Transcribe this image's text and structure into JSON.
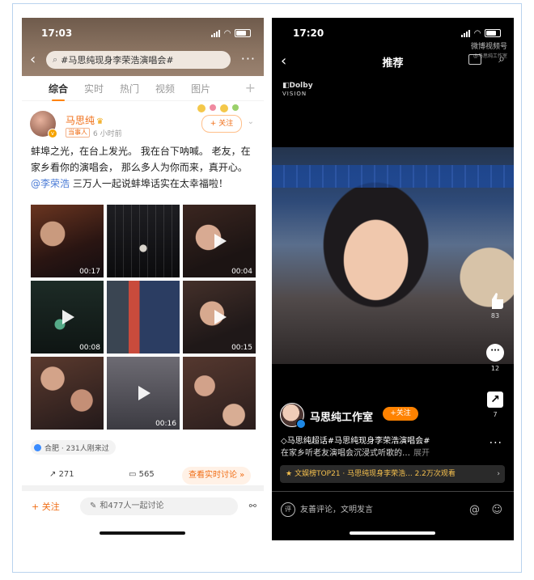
{
  "left": {
    "status": {
      "time": "17:03"
    },
    "search": {
      "query": "#马思纯现身李荣浩演唱会#"
    },
    "tabs": [
      "综合",
      "实时",
      "热门",
      "视频",
      "图片"
    ],
    "post": {
      "author": "马思纯",
      "role_badge": "当事人",
      "time": "6 小时前",
      "follow": "+ 关注",
      "text_a": "蚌埠之光，在台上发光。 我在台下呐喊。 老友，在家乡看你的演唱会， 那么多人为你而来，真开心。",
      "mention": "@李荣浩",
      "text_b": " 三万人一起说蚌埠话实在太幸福啦！",
      "media_durations": [
        "00:17",
        "",
        "00:04",
        "00:08",
        "",
        "00:15",
        "",
        "00:16",
        ""
      ],
      "location": "合肥 · 231人刚来过",
      "reposts": "271",
      "comments": "565",
      "discuss_realtime": "查看实时讨论"
    },
    "bottom": {
      "follow": "+ 关注",
      "comment_box": "和477人一起讨论"
    }
  },
  "right": {
    "status": {
      "time": "17:20"
    },
    "title": "推荐",
    "watermark": "微博视频号",
    "watermark_sub": "@马思纯工作室",
    "dolby": "Dolby",
    "dolby_sub": "VISION",
    "likes": "83",
    "comments": "12",
    "shares": "7",
    "author": "马思纯工作室",
    "follow": "+关注",
    "desc_line1": "◇马思纯超话#马思纯现身李荣浩演唱会#",
    "desc_line2": "在家乡听老友演唱会沉浸式听歌的…",
    "expand": "展开",
    "rank": "文娱榜TOP21 · 马思纯现身李荣浩...   2.2万次观看",
    "comment_placeholder": "友善评论，文明发言"
  }
}
